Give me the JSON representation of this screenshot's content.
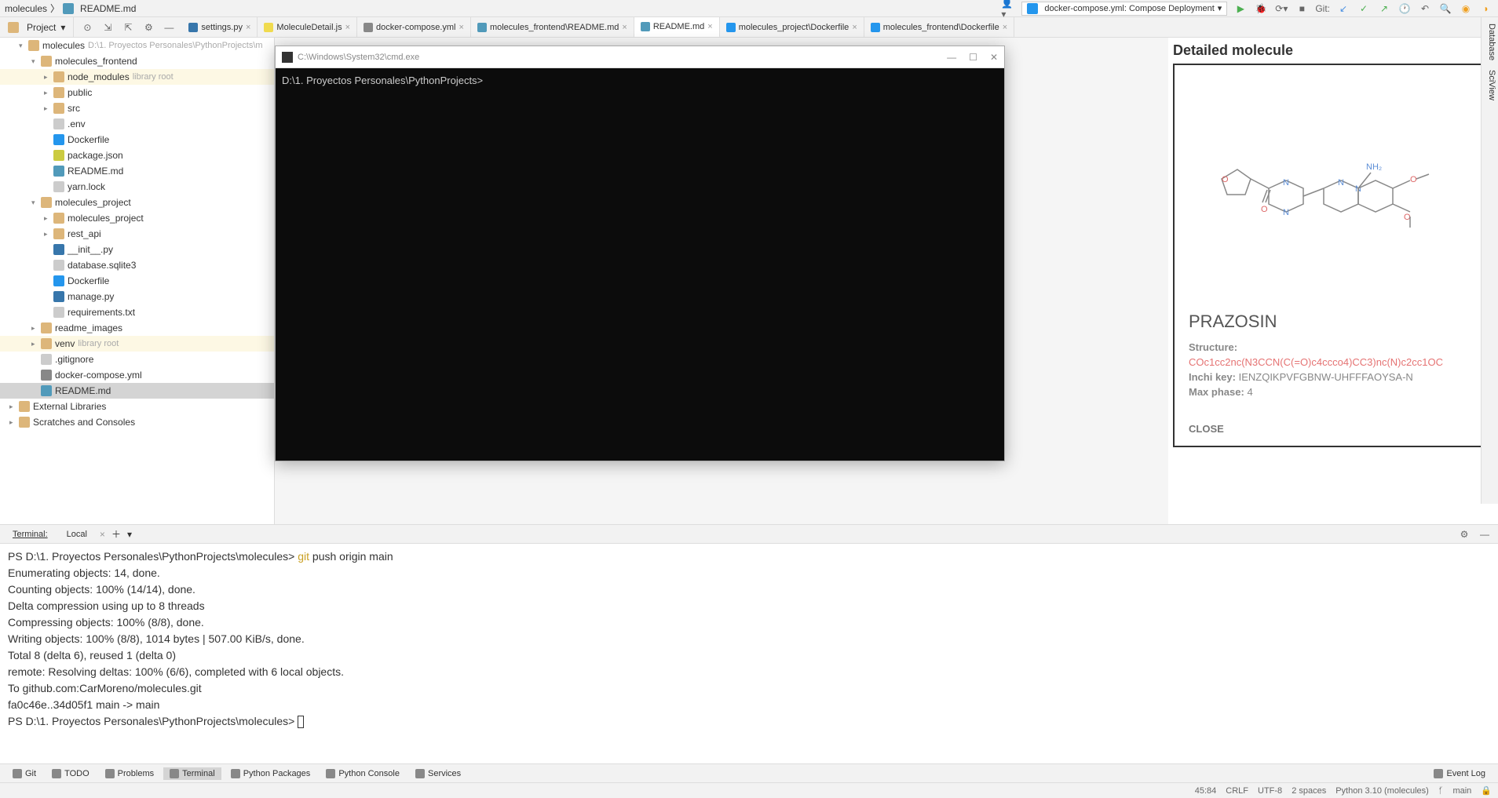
{
  "breadcrumb": {
    "root": "molecules",
    "file": "README.md"
  },
  "run_config": {
    "label": "docker-compose.yml: Compose Deployment"
  },
  "git_label": "Git:",
  "project_selector": "Project",
  "tabs": [
    {
      "label": "settings.py",
      "icon": "py"
    },
    {
      "label": "MoleculeDetail.js",
      "icon": "js"
    },
    {
      "label": "docker-compose.yml",
      "icon": "yml"
    },
    {
      "label": "molecules_frontend\\README.md",
      "icon": "md"
    },
    {
      "label": "README.md",
      "icon": "md",
      "active": true
    },
    {
      "label": "molecules_project\\Dockerfile",
      "icon": "docker"
    },
    {
      "label": "molecules_frontend\\Dockerfile",
      "icon": "docker"
    }
  ],
  "tree": {
    "root": {
      "name": "molecules",
      "path": "D:\\1. Proyectos Personales\\PythonProjects\\m"
    },
    "items": [
      {
        "depth": 0,
        "arrow": "▾",
        "icon": "folder-open",
        "name": "molecules",
        "suffix": "D:\\1. Proyectos Personales\\PythonProjects\\m"
      },
      {
        "depth": 1,
        "arrow": "▾",
        "icon": "folder-open",
        "name": "molecules_frontend"
      },
      {
        "depth": 2,
        "arrow": "▸",
        "icon": "folder",
        "name": "node_modules",
        "suffix": "library root",
        "lib": true
      },
      {
        "depth": 2,
        "arrow": "▸",
        "icon": "folder",
        "name": "public"
      },
      {
        "depth": 2,
        "arrow": "▸",
        "icon": "folder",
        "name": "src"
      },
      {
        "depth": 2,
        "arrow": "",
        "icon": "file",
        "name": ".env"
      },
      {
        "depth": 2,
        "arrow": "",
        "icon": "docker",
        "name": "Dockerfile"
      },
      {
        "depth": 2,
        "arrow": "",
        "icon": "json",
        "name": "package.json"
      },
      {
        "depth": 2,
        "arrow": "",
        "icon": "md",
        "name": "README.md"
      },
      {
        "depth": 2,
        "arrow": "",
        "icon": "file",
        "name": "yarn.lock"
      },
      {
        "depth": 1,
        "arrow": "▾",
        "icon": "folder-open",
        "name": "molecules_project"
      },
      {
        "depth": 2,
        "arrow": "▸",
        "icon": "folder",
        "name": "molecules_project"
      },
      {
        "depth": 2,
        "arrow": "▸",
        "icon": "folder",
        "name": "rest_api"
      },
      {
        "depth": 2,
        "arrow": "",
        "icon": "py",
        "name": "__init__.py"
      },
      {
        "depth": 2,
        "arrow": "",
        "icon": "file",
        "name": "database.sqlite3"
      },
      {
        "depth": 2,
        "arrow": "",
        "icon": "docker",
        "name": "Dockerfile"
      },
      {
        "depth": 2,
        "arrow": "",
        "icon": "py",
        "name": "manage.py"
      },
      {
        "depth": 2,
        "arrow": "",
        "icon": "file",
        "name": "requirements.txt"
      },
      {
        "depth": 1,
        "arrow": "▸",
        "icon": "folder",
        "name": "readme_images"
      },
      {
        "depth": 1,
        "arrow": "▸",
        "icon": "folder",
        "name": "venv",
        "suffix": "library root",
        "lib": true
      },
      {
        "depth": 1,
        "arrow": "",
        "icon": "file",
        "name": ".gitignore"
      },
      {
        "depth": 1,
        "arrow": "",
        "icon": "yml",
        "name": "docker-compose.yml"
      },
      {
        "depth": 1,
        "arrow": "",
        "icon": "md",
        "name": "README.md",
        "selected": true
      },
      {
        "depth": 0,
        "arrow": "▸",
        "icon": "folder",
        "name": "External Libraries",
        "root": true
      },
      {
        "depth": 0,
        "arrow": "▸",
        "icon": "folder",
        "name": "Scratches and Consoles",
        "root": true
      }
    ]
  },
  "cmd": {
    "title": "C:\\Windows\\System32\\cmd.exe",
    "prompt": "D:\\1. Proyectos Personales\\PythonProjects>"
  },
  "molecule": {
    "heading": "Detailed molecule",
    "name": "PRAZOSIN",
    "structure_label": "Structure:",
    "smiles": "COc1cc2nc(N3CCN(C(=O)c4ccco4)CC3)nc(N)c2cc1OC",
    "inchi_label": "Inchi key:",
    "inchi": "IENZQIKPVFGBNW-UHFFFAOYSA-N",
    "maxphase_label": "Max phase:",
    "maxphase": "4",
    "close": "CLOSE"
  },
  "right_rail": {
    "db": "Database",
    "sci": "SciView"
  },
  "terminal": {
    "title": "Terminal:",
    "tab": "Local",
    "lines": [
      {
        "prefix": "PS D:\\1. Proyectos Personales\\PythonProjects\\molecules> ",
        "git": "git",
        "rest": " push origin main"
      },
      {
        "text": "Enumerating objects: 14, done."
      },
      {
        "text": "Counting objects: 100% (14/14), done."
      },
      {
        "text": "Delta compression using up to 8 threads"
      },
      {
        "text": "Compressing objects: 100% (8/8), done."
      },
      {
        "text": "Writing objects: 100% (8/8), 1014 bytes | 507.00 KiB/s, done."
      },
      {
        "text": "Total 8 (delta 6), reused 1 (delta 0)"
      },
      {
        "text": "remote: Resolving deltas: 100% (6/6), completed with 6 local objects."
      },
      {
        "text": "To github.com:CarMoreno/molecules.git"
      },
      {
        "text": "   fa0c46e..34d05f1  main -> main"
      },
      {
        "prefix": "PS D:\\1. Proyectos Personales\\PythonProjects\\molecules> ",
        "cursor": true
      }
    ]
  },
  "bottom_tools": [
    {
      "label": "Git",
      "icon": "git"
    },
    {
      "label": "TODO",
      "icon": "todo"
    },
    {
      "label": "Problems",
      "icon": "problems"
    },
    {
      "label": "Terminal",
      "icon": "terminal",
      "active": true
    },
    {
      "label": "Python Packages",
      "icon": "pkg"
    },
    {
      "label": "Python Console",
      "icon": "console"
    },
    {
      "label": "Services",
      "icon": "services"
    }
  ],
  "event_log": "Event Log",
  "status": {
    "pos": "45:84",
    "line_sep": "CRLF",
    "encoding": "UTF-8",
    "indent": "2 spaces",
    "python": "Python 3.10 (molecules)",
    "branch": "main"
  }
}
